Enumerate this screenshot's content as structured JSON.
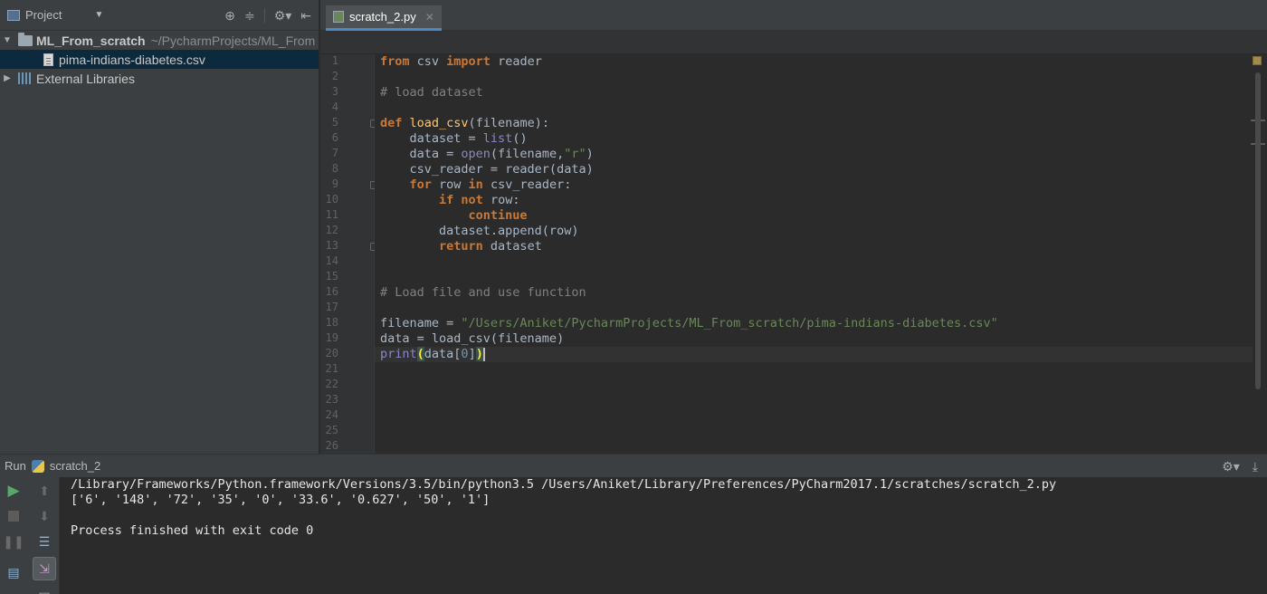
{
  "project_panel": {
    "title": "Project",
    "tree": [
      {
        "label": "ML_From_scratch",
        "suffix": "~/PycharmProjects/ML_From",
        "expanded": true
      },
      {
        "label": "pima-indians-diabetes.csv",
        "selected": true
      },
      {
        "label": "External Libraries",
        "expanded": false
      }
    ]
  },
  "editor": {
    "tab_label": "scratch_2.py",
    "line_numbers": [
      "1",
      "2",
      "3",
      "4",
      "5",
      "6",
      "7",
      "8",
      "9",
      "10",
      "11",
      "12",
      "13",
      "14",
      "15",
      "16",
      "17",
      "18",
      "19",
      "20",
      "21",
      "22",
      "23",
      "24",
      "25",
      "26"
    ],
    "code": {
      "l1_from": "from",
      "l1_mod": " csv ",
      "l1_import": "import",
      "l1_name": " reader",
      "l3_comment": "# load dataset",
      "l5_def": "def",
      "l5_fn": " load_csv",
      "l5_rest": "(filename):",
      "l6_a": "    dataset = ",
      "l6_list": "list",
      "l6_b": "()",
      "l7_a": "    data = ",
      "l7_open": "open",
      "l7_b": "(filename,",
      "l7_str": "\"r\"",
      "l7_c": ")",
      "l8": "    csv_reader = reader(data)",
      "l9_for": "    for",
      "l9_a": " row ",
      "l9_in": "in",
      "l9_b": " csv_reader:",
      "l10_if": "        if",
      "l10_sp": " ",
      "l10_not": "not",
      "l10_b": " row:",
      "l11_continue": "            continue",
      "l12": "        dataset.append(row)",
      "l13_return": "        return",
      "l13_b": " dataset",
      "l16_comment": "# Load file and use function",
      "l18_a": "filename = ",
      "l18_str": "\"/Users/Aniket/PycharmProjects/ML_From_scratch/pima-indians-diabetes.csv\"",
      "l19": "data = load_csv(filename)",
      "l20_print": "print",
      "l20_open": "(",
      "l20_a": "data[",
      "l20_num": "0",
      "l20_b": "]",
      "l20_close": ")"
    }
  },
  "run_panel": {
    "label": "Run",
    "config": "scratch_2",
    "output": [
      "/Library/Frameworks/Python.framework/Versions/3.5/bin/python3.5 /Users/Aniket/Library/Preferences/PyCharm2017.1/scratches/scratch_2.py",
      "['6', '148', '72', '35', '0', '33.6', '0.627', '50', '1']",
      "Process finished with exit code 0"
    ]
  },
  "colors": {
    "keyword": "#cc7832",
    "function": "#ffc66d",
    "builtin": "#8888c6",
    "string": "#6a8759",
    "number": "#6897bb",
    "comment": "#808080",
    "run_green": "#59a869"
  }
}
